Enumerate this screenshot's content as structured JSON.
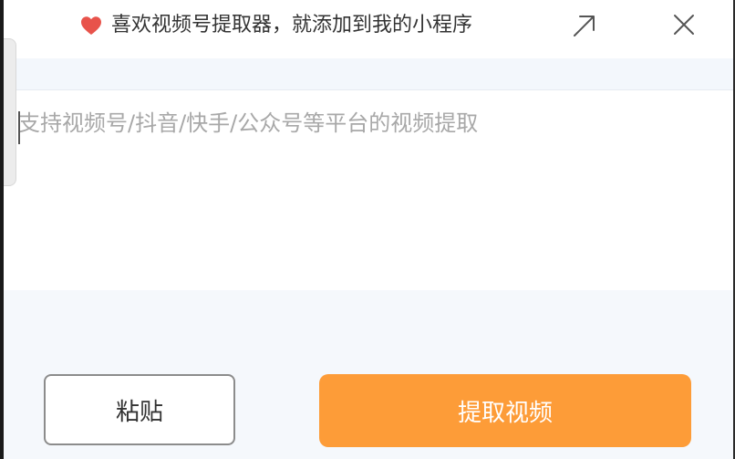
{
  "banner": {
    "text": "喜欢视频号提取器，就添加到我的小程序",
    "heart_icon": "heart-icon",
    "open_icon": "arrow-up-right-icon",
    "close_icon": "close-icon",
    "heart_color": "#e8534b"
  },
  "input": {
    "placeholder": "支持视频号/抖音/快手/公众号等平台的视频提取",
    "value": ""
  },
  "actions": {
    "paste_label": "粘贴",
    "extract_label": "提取视频",
    "accent_color": "#fd9c38"
  }
}
